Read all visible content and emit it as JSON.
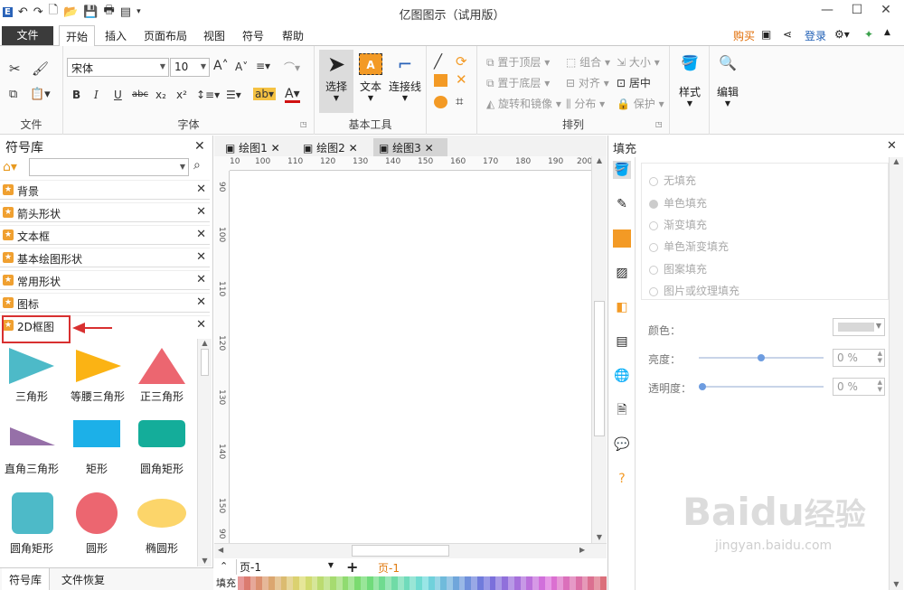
{
  "app": {
    "title": "亿图图示（试用版）"
  },
  "ribbon_tabs": {
    "file": "文件",
    "items": [
      "开始",
      "插入",
      "页面布局",
      "视图",
      "符号",
      "帮助"
    ]
  },
  "top_right": {
    "buy": "购买",
    "login": "登录"
  },
  "font": {
    "name": "宋体",
    "size": "10",
    "group_label": "字体"
  },
  "groups": {
    "file": "文件",
    "basic_tools": "基本工具",
    "arrange": "排列"
  },
  "tools": {
    "select": "选择",
    "text": "文本",
    "connector": "连接线",
    "style": "样式",
    "edit": "编辑"
  },
  "arrange": {
    "bring_top": "置于顶层",
    "send_bottom": "置于底层",
    "rotate": "旋转和镜像",
    "group": "组合",
    "align": "对齐",
    "distribute": "分布",
    "size": "大小",
    "center": "居中",
    "protect": "保护"
  },
  "symbol_library": {
    "title": "符号库",
    "search_placeholder": "",
    "items": [
      "背景",
      "箭头形状",
      "文本框",
      "基本绘图形状",
      "常用形状",
      "图标",
      "2D框图"
    ],
    "shapes": [
      "三角形",
      "等腰三角形",
      "正三角形",
      "直角三角形",
      "矩形",
      "圆角矩形",
      "圆角矩形",
      "圆形",
      "椭圆形"
    ],
    "bottom_tabs": [
      "符号库",
      "文件恢复"
    ]
  },
  "doc_tabs": [
    "绘图1",
    "绘图2",
    "绘图3"
  ],
  "ruler": {
    "h": [
      "10",
      "100",
      "110",
      "120",
      "130",
      "140",
      "150",
      "160",
      "170",
      "180",
      "190",
      "200"
    ],
    "v": [
      "90",
      "100",
      "110",
      "120",
      "130",
      "140",
      "150",
      "90"
    ]
  },
  "page_bar": {
    "page_select": "页-1",
    "page_tab": "页-1",
    "fill_label": "填充"
  },
  "fill_panel": {
    "title": "填充",
    "options": [
      "无填充",
      "单色填充",
      "渐变填充",
      "单色渐变填充",
      "图案填充",
      "图片或纹理填充"
    ],
    "color_label": "颜色：",
    "brightness_label": "亮度：",
    "brightness_value": "0 %",
    "brightness_level": 0.5,
    "transparency_label": "透明度：",
    "transparency_value": "0 %",
    "transparency_level": 0.0
  },
  "watermark": {
    "brand": "Baidu",
    "suffix": "经验",
    "url": "jingyan.baidu.com"
  }
}
